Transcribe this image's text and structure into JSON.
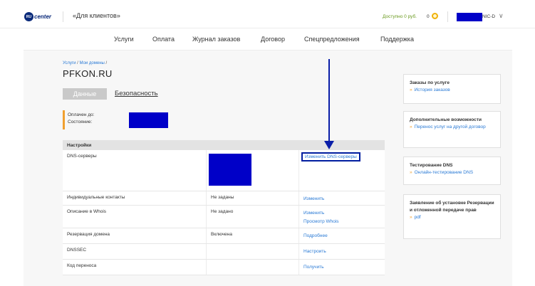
{
  "header": {
    "logo_mark": "RU",
    "logo_text": "center",
    "clients_label": "«Для клиентов»",
    "balance_label": "Доступно 0 руб.",
    "cart_count": "0",
    "user_suffix": "NIC-D",
    "user_chevron": "∨"
  },
  "nav": {
    "items": [
      {
        "label": "Услуги"
      },
      {
        "label": "Оплата"
      },
      {
        "label": "Журнал заказов"
      },
      {
        "label": "Договор"
      },
      {
        "label": "Спецпредложения"
      },
      {
        "label": "Поддержка"
      }
    ]
  },
  "breadcrumb": {
    "items": [
      "Услуги",
      "Мои домены"
    ],
    "separator": "/"
  },
  "domain": {
    "title": "PFKON.RU"
  },
  "tabs": {
    "data_label": "Данные",
    "security_label": "Безопасность"
  },
  "status": {
    "paid_until_label": "Оплачен до:",
    "state_label": "Состояние:"
  },
  "settings": {
    "header": "Настройки",
    "rows": [
      {
        "name": "DNS-серверы",
        "value": "",
        "links": [
          "Изменить DNS-серверы"
        ]
      },
      {
        "name": "Индивидуальные контакты",
        "value": "Не заданы",
        "links": [
          "Изменить"
        ]
      },
      {
        "name": "Описание в Whois",
        "value": "Не задано",
        "links": [
          "Изменить",
          "Просмотр Whois"
        ]
      },
      {
        "name": "Резервация домена",
        "value": "Включена",
        "links": [
          "Подробнее"
        ]
      },
      {
        "name": "DNSSEC",
        "value": "",
        "links": [
          "Настроить"
        ]
      },
      {
        "name": "Код переноса",
        "value": "",
        "links": [
          "Получить"
        ]
      }
    ]
  },
  "sidebar": {
    "boxes": [
      {
        "title": "Заказы по услуге",
        "links": [
          "История заказов"
        ]
      },
      {
        "title": "Дополнительные возможности",
        "links": [
          "Перенос услуг на другой договор"
        ]
      },
      {
        "title": "Тестирование DNS",
        "links": [
          "Онлайн-тестирование DNS"
        ]
      },
      {
        "title": "Заявление об установке Резервации и отложенной передаче прав",
        "links": [
          "pdf"
        ]
      }
    ]
  },
  "colors": {
    "link": "#2a7ad5",
    "accent_orange": "#f0a030",
    "redaction": "#0000c8",
    "annotation": "#0a1ea8",
    "balance_green": "#6a9a1f"
  }
}
